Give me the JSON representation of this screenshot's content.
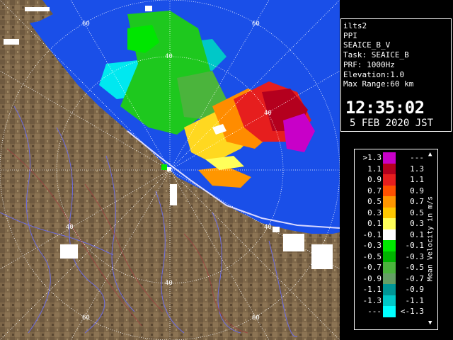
{
  "info": {
    "site": "ilts2",
    "product": "PPI",
    "product_name": "SEAICE_B_V",
    "task": "Task: SEAICE_B",
    "prf": "PRF: 1000Hz",
    "elevation": "Elevation:1.0",
    "max_range": "Max Range:60 km",
    "time": "12:35:02",
    "date": "5 FEB 2020 JST"
  },
  "range_ring_labels": [
    "60",
    "40",
    "40",
    "40",
    "40",
    "60",
    "60",
    "40",
    "60"
  ],
  "legend": {
    "unit_label": "Mean Velocity in m/s",
    "rows": [
      {
        "left": ">1.3",
        "right": "---",
        "color": "#c800c8"
      },
      {
        "left": "1.1",
        "right": "1.3",
        "color": "#b4001e"
      },
      {
        "left": "0.9",
        "right": "1.1",
        "color": "#e61e1e"
      },
      {
        "left": "0.7",
        "right": "0.9",
        "color": "#ff5000"
      },
      {
        "left": "0.5",
        "right": "0.7",
        "color": "#ff9600"
      },
      {
        "left": "0.3",
        "right": "0.5",
        "color": "#ffc800"
      },
      {
        "left": "0.1",
        "right": "0.3",
        "color": "#ffff5a"
      },
      {
        "left": "-0.1",
        "right": "0.1",
        "color": "#ffffff"
      },
      {
        "left": "-0.3",
        "right": "-0.1",
        "color": "#00e600"
      },
      {
        "left": "-0.5",
        "right": "-0.3",
        "color": "#00b400"
      },
      {
        "left": "-0.7",
        "right": "-0.5",
        "color": "#4bb43c"
      },
      {
        "left": "-0.9",
        "right": "-0.7",
        "color": "#64a064"
      },
      {
        "left": "-1.1",
        "right": "-0.9",
        "color": "#009696"
      },
      {
        "left": "-1.3",
        "right": "-1.1",
        "color": "#00c8c8"
      },
      {
        "left": "---",
        "right": "<-1.3",
        "color": "#00ffff"
      }
    ]
  },
  "colors": {
    "sea": "#1a4fe8",
    "land": "#7a6448",
    "ring": "#ffffff"
  }
}
